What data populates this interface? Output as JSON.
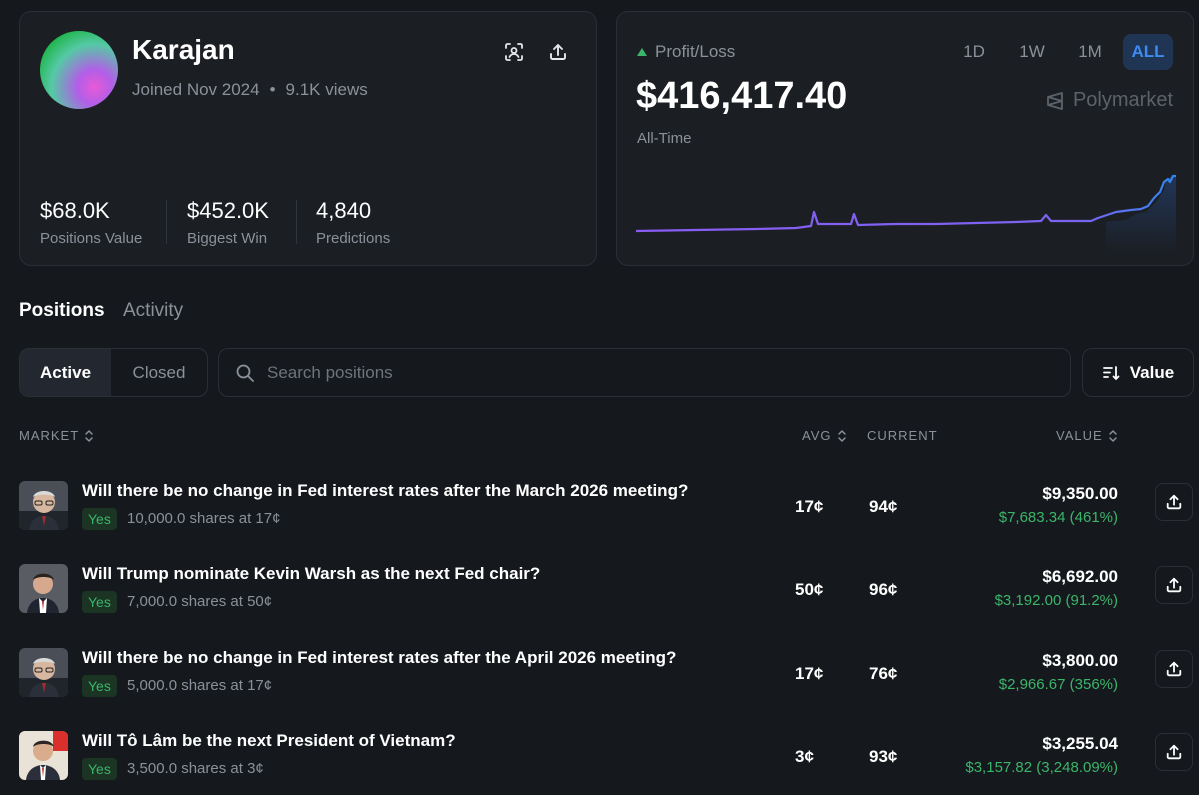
{
  "profile": {
    "username": "Karajan",
    "joined": "Joined Nov 2024",
    "separator": "•",
    "views": "9.1K views",
    "icons": [
      "scan-icon",
      "share-icon"
    ],
    "stats": [
      {
        "value": "$68.0K",
        "label": "Positions Value"
      },
      {
        "value": "$452.0K",
        "label": "Biggest Win"
      },
      {
        "value": "4,840",
        "label": "Predictions"
      }
    ]
  },
  "pnl": {
    "label": "Profit/Loss",
    "amount": "$416,417.40",
    "period": "All-Time",
    "ranges": [
      "1D",
      "1W",
      "1M",
      "ALL"
    ],
    "active_range": "ALL",
    "brand": "Polymarket",
    "colors": {
      "positive": "#3bb56a",
      "line_start": "#8a5cf5",
      "line_end": "#2f86f0"
    }
  },
  "tabs": {
    "positions": "Positions",
    "activity": "Activity"
  },
  "filters": {
    "active": "Active",
    "closed": "Closed",
    "search_placeholder": "Search positions",
    "sort_label": "Value"
  },
  "table": {
    "headers": {
      "market": "MARKET",
      "avg": "AVG",
      "current": "CURRENT",
      "value": "VALUE"
    },
    "rows": [
      {
        "title": "Will there be no change in Fed interest rates after the March 2026 meeting?",
        "outcome": "Yes",
        "shares": "10,000.0 shares at 17¢",
        "avg": "17¢",
        "current": "94¢",
        "value": "$9,350.00",
        "pnl": "$7,683.34 (461%)"
      },
      {
        "title": "Will Trump nominate Kevin Warsh as the next Fed chair?",
        "outcome": "Yes",
        "shares": "7,000.0 shares at 50¢",
        "avg": "50¢",
        "current": "96¢",
        "value": "$6,692.00",
        "pnl": "$3,192.00 (91.2%)"
      },
      {
        "title": "Will there be no change in Fed interest rates after the April 2026 meeting?",
        "outcome": "Yes",
        "shares": "5,000.0 shares at 17¢",
        "avg": "17¢",
        "current": "76¢",
        "value": "$3,800.00",
        "pnl": "$2,966.67 (356%)"
      },
      {
        "title": "Will Tô Lâm be the next President of Vietnam?",
        "outcome": "Yes",
        "shares": "3,500.0 shares at 3¢",
        "avg": "3¢",
        "current": "93¢",
        "value": "$3,255.04",
        "pnl": "$3,157.82 (3,248.09%)"
      }
    ]
  }
}
